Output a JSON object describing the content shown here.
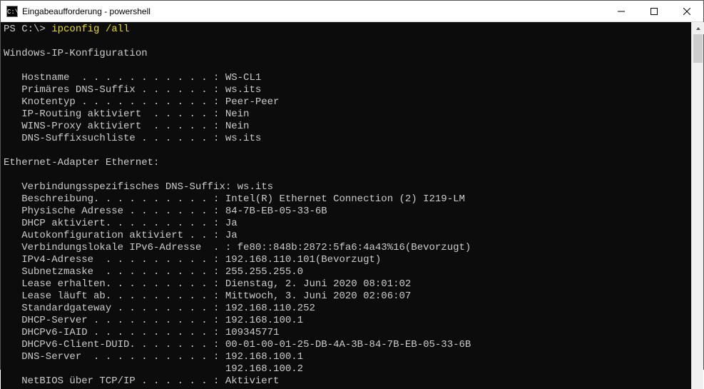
{
  "window": {
    "title": "Eingabeaufforderung - powershell"
  },
  "prompt": {
    "text": "PS C:\\> ",
    "command": "ipconfig /all"
  },
  "output": {
    "header": "Windows-IP-Konfiguration",
    "config_lines": [
      "   Hostname  . . . . . . . . . . . : WS-CL1",
      "   Primäres DNS-Suffix . . . . . . : ws.its",
      "   Knotentyp . . . . . . . . . . . : Peer-Peer",
      "   IP-Routing aktiviert  . . . . . : Nein",
      "   WINS-Proxy aktiviert  . . . . . : Nein",
      "   DNS-Suffixsuchliste . . . . . . : ws.its"
    ],
    "adapter_header": "Ethernet-Adapter Ethernet:",
    "adapter_lines": [
      "   Verbindungsspezifisches DNS-Suffix: ws.its",
      "   Beschreibung. . . . . . . . . . : Intel(R) Ethernet Connection (2) I219-LM",
      "   Physische Adresse . . . . . . . : 84-7B-EB-05-33-6B",
      "   DHCP aktiviert. . . . . . . . . : Ja",
      "   Autokonfiguration aktiviert . . : Ja",
      "   Verbindungslokale IPv6-Adresse  . : fe80::848b:2872:5fa6:4a43%16(Bevorzugt)",
      "   IPv4-Adresse  . . . . . . . . . : 192.168.110.101(Bevorzugt)",
      "   Subnetzmaske  . . . . . . . . . : 255.255.255.0",
      "   Lease erhalten. . . . . . . . . : Dienstag, 2. Juni 2020 08:01:02",
      "   Lease läuft ab. . . . . . . . . : Mittwoch, 3. Juni 2020 02:06:07",
      "   Standardgateway . . . . . . . . : 192.168.110.252",
      "   DHCP-Server . . . . . . . . . . : 192.168.100.1",
      "   DHCPv6-IAID . . . . . . . . . . : 109345771",
      "   DHCPv6-Client-DUID. . . . . . . : 00-01-00-01-25-DB-4A-3B-84-7B-EB-05-33-6B",
      "   DNS-Server  . . . . . . . . . . : 192.168.100.1",
      "                                     192.168.100.2",
      "   NetBIOS über TCP/IP . . . . . . : Aktiviert"
    ]
  }
}
